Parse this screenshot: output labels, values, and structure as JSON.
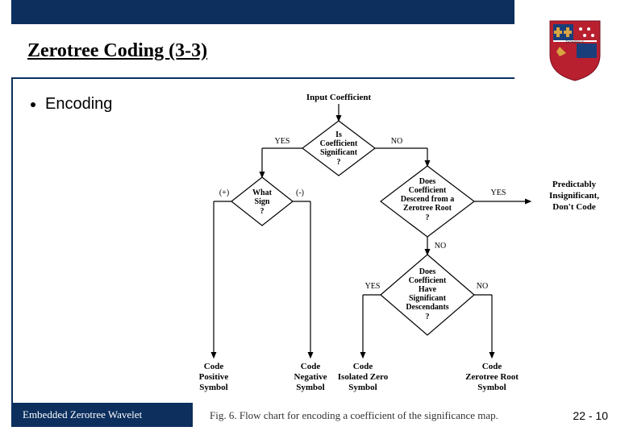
{
  "header": {
    "title": "Zerotree Coding (3-3)"
  },
  "bullet": {
    "text": "Encoding"
  },
  "footer": {
    "text": "Embedded Zerotree Wavelet",
    "page": "22 - 10"
  },
  "diagram": {
    "input": "Input Coefficient",
    "d1": {
      "l1": "Is",
      "l2": "Coefficient",
      "l3": "Significant",
      "l4": "?",
      "yes": "YES",
      "no": "NO"
    },
    "d2": {
      "l1": "What",
      "l2": "Sign",
      "l3": "?",
      "plus": "(+)",
      "minus": "(-)"
    },
    "d3": {
      "l1": "Does",
      "l2": "Coefficient",
      "l3": "Descend from a",
      "l4": "Zerotree Root",
      "l5": "?",
      "yes": "YES",
      "no": "NO"
    },
    "d3out": {
      "l1": "Predictably",
      "l2": "Insignificant,",
      "l3": "Don't Code"
    },
    "d4": {
      "l1": "Does",
      "l2": "Coefficient",
      "l3": "Have",
      "l4": "Significant",
      "l5": "Descendants",
      "l6": "?",
      "yes": "YES",
      "no": "NO"
    },
    "out1": {
      "l1": "Code",
      "l2": "Positive",
      "l3": "Symbol"
    },
    "out2": {
      "l1": "Code",
      "l2": "Negative",
      "l3": "Symbol"
    },
    "out3": {
      "l1": "Code",
      "l2": "Isolated Zero",
      "l3": "Symbol"
    },
    "out4": {
      "l1": "Code",
      "l2": "Zerotree Root",
      "l3": "Symbol"
    },
    "caption": "Fig. 6.   Flow chart for encoding a coefficient of the significance map."
  }
}
